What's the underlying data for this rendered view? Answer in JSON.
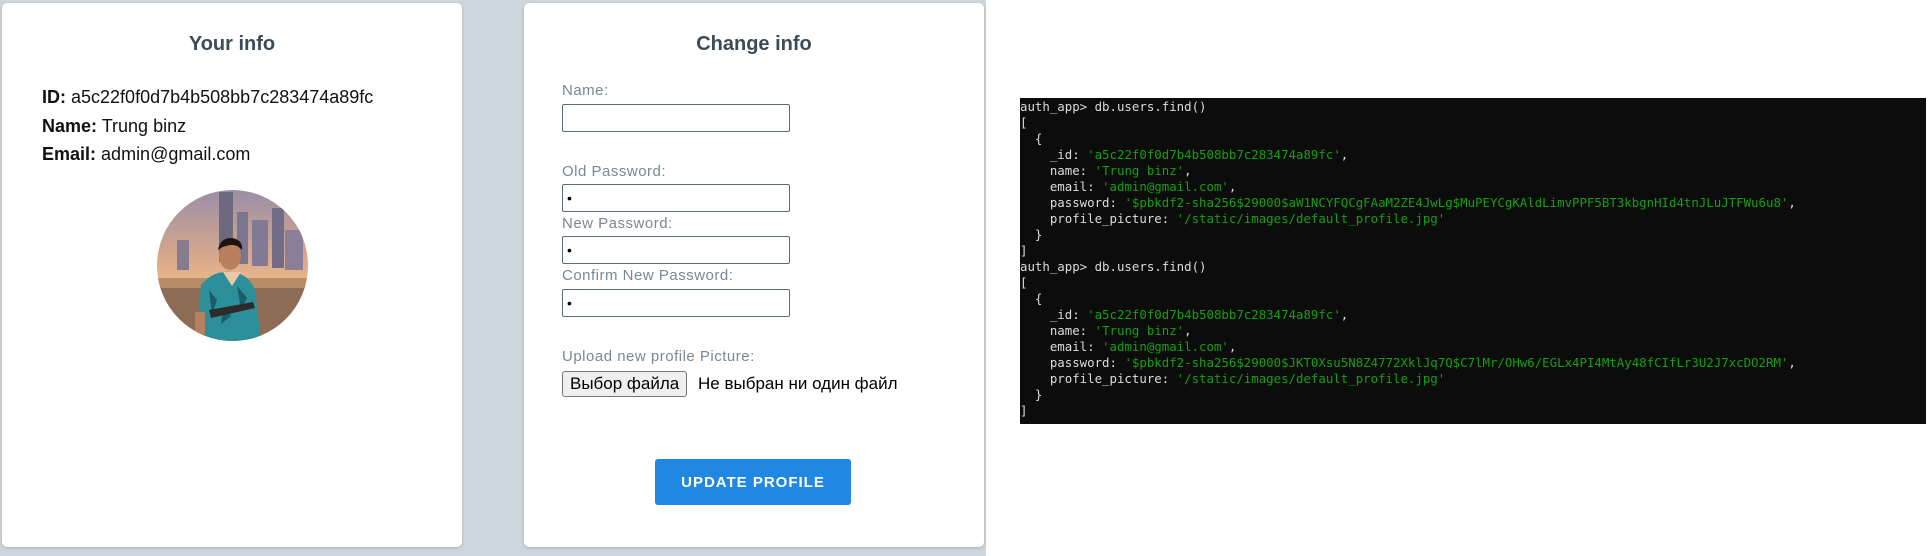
{
  "info_card": {
    "title": "Your info",
    "id_label": "ID:",
    "id_value": "a5c22f0f0d7b4b508bb7c283474a89fc",
    "name_label": "Name:",
    "name_value": "Trung binz",
    "email_label": "Email:",
    "email_value": "admin@gmail.com"
  },
  "change_card": {
    "title": "Change info",
    "name_label": "Name:",
    "name_value": "",
    "old_password_label": "Old Password:",
    "old_password_value": "•",
    "new_password_label": "New Password:",
    "new_password_value": "•",
    "confirm_password_label": "Confirm New Password:",
    "confirm_password_value": "•",
    "upload_label": "Upload new profile Picture:",
    "file_button_label": "Выбор файла",
    "file_status": "Не выбран ни один файл",
    "update_button_label": "UPDATE PROFILE"
  },
  "terminal": {
    "lines": [
      [
        {
          "t": "auth_app> db.users.find()"
        }
      ],
      [
        {
          "t": "["
        }
      ],
      [
        {
          "t": "  {"
        }
      ],
      [
        {
          "t": "    _id: "
        },
        {
          "t": "'a5c22f0f0d7b4b508bb7c283474a89fc'",
          "s": 1
        },
        {
          "t": ","
        }
      ],
      [
        {
          "t": "    name: "
        },
        {
          "t": "'Trung binz'",
          "s": 1
        },
        {
          "t": ","
        }
      ],
      [
        {
          "t": "    email: "
        },
        {
          "t": "'admin@gmail.com'",
          "s": 1
        },
        {
          "t": ","
        }
      ],
      [
        {
          "t": "    password: "
        },
        {
          "t": "'$pbkdf2-sha256$29000$aW1NCYFQCgFAaM2ZE4JwLg$MuPEYCgKAldLimvPPF5BT3kbgnHId4tnJLuJTFWu6u8'",
          "s": 1
        },
        {
          "t": ","
        }
      ],
      [
        {
          "t": "    profile_picture: "
        },
        {
          "t": "'/static/images/default_profile.jpg'",
          "s": 1
        }
      ],
      [
        {
          "t": "  }"
        }
      ],
      [
        {
          "t": "]"
        }
      ],
      [
        {
          "t": "auth_app> db.users.find()"
        }
      ],
      [
        {
          "t": "["
        }
      ],
      [
        {
          "t": "  {"
        }
      ],
      [
        {
          "t": "    _id: "
        },
        {
          "t": "'a5c22f0f0d7b4b508bb7c283474a89fc'",
          "s": 1
        },
        {
          "t": ","
        }
      ],
      [
        {
          "t": "    name: "
        },
        {
          "t": "'Trung binz'",
          "s": 1
        },
        {
          "t": ","
        }
      ],
      [
        {
          "t": "    email: "
        },
        {
          "t": "'admin@gmail.com'",
          "s": 1
        },
        {
          "t": ","
        }
      ],
      [
        {
          "t": "    password: "
        },
        {
          "t": "'$pbkdf2-sha256$29000$JKT0Xsu5N8Z4772XklJq7Q$C7lMr/OHw6/EGLx4PI4MtAy48fCIfLr3U2J7xcDO2RM'",
          "s": 1
        },
        {
          "t": ","
        }
      ],
      [
        {
          "t": "    profile_picture: "
        },
        {
          "t": "'/static/images/default_profile.jpg'",
          "s": 1
        }
      ],
      [
        {
          "t": "  }"
        }
      ],
      [
        {
          "t": "]"
        }
      ]
    ]
  },
  "colors": {
    "accent": "#2088e3",
    "page_background": "#cdd6dd",
    "terminal_background": "#0c0c0c",
    "terminal_string": "#13a10e",
    "terminal_text": "#dcdcdc"
  }
}
